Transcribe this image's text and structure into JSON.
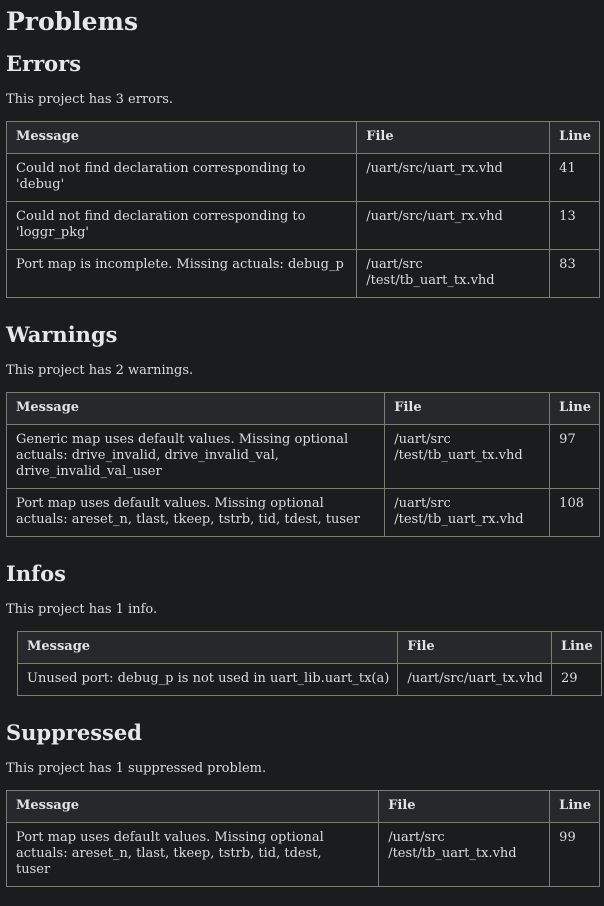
{
  "title": "Problems",
  "sections": {
    "errors": {
      "heading": "Errors",
      "summary": "This project has 3 errors.",
      "columns": [
        "Message",
        "File",
        "Line"
      ],
      "rows": [
        {
          "message": "Could not find declaration corresponding to 'debug'",
          "file": "/uart/src/uart_rx.vhd",
          "line": "41"
        },
        {
          "message": "Could not find declaration corresponding to 'loggr_pkg'",
          "file": "/uart/src/uart_rx.vhd",
          "line": "13"
        },
        {
          "message": "Port map is incomplete. Missing actuals: debug_p",
          "file": "/uart/src /test/tb_uart_tx.vhd",
          "line": "83"
        }
      ]
    },
    "warnings": {
      "heading": "Warnings",
      "summary": "This project has 2 warnings.",
      "columns": [
        "Message",
        "File",
        "Line"
      ],
      "rows": [
        {
          "message": "Generic map uses default values. Missing optional actuals: drive_invalid, drive_invalid_val, drive_invalid_val_user",
          "file": "/uart/src /test/tb_uart_tx.vhd",
          "line": "97"
        },
        {
          "message": "Port map uses default values. Missing optional actuals: areset_n, tlast, tkeep, tstrb, tid, tdest, tuser",
          "file": "/uart/src /test/tb_uart_rx.vhd",
          "line": "108"
        }
      ]
    },
    "infos": {
      "heading": "Infos",
      "summary": "This project has 1 info.",
      "columns": [
        "Message",
        "File",
        "Line"
      ],
      "rows": [
        {
          "message": "Unused port: debug_p is not used in uart_lib.uart_tx(a)",
          "file": "/uart/src/uart_tx.vhd",
          "line": "29"
        }
      ]
    },
    "suppressed": {
      "heading": "Suppressed",
      "summary": "This project has 1 suppressed problem.",
      "columns": [
        "Message",
        "File",
        "Line"
      ],
      "rows": [
        {
          "message": "Port map uses default values. Missing optional actuals: areset_n, tlast, tkeep, tstrb, tid, tdest, tuser",
          "file": "/uart/src /test/tb_uart_tx.vhd",
          "line": "99"
        }
      ]
    }
  }
}
